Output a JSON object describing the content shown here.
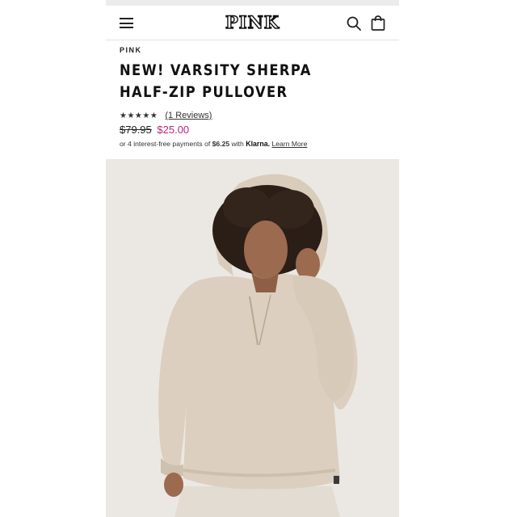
{
  "header": {
    "logo": "PINK",
    "menu_icon": "hamburger-menu-icon",
    "search_icon": "search-icon",
    "bag_icon": "shopping-bag-icon"
  },
  "product": {
    "brand": "PINK",
    "title": "NEW! VARSITY SHERPA HALF-ZIP PULLOVER",
    "stars": "★★★★★",
    "reviews_link": "(1 Reviews)",
    "original_price": "$79.95",
    "sale_price": "$25.00",
    "installment": {
      "prefix": "or 4 interest-free payments of",
      "amount": "$6.25",
      "with": "with",
      "provider": "Klarna.",
      "learn_more": "Learn More"
    }
  },
  "colors": {
    "sale_price": "#b8287a",
    "text": "#111111",
    "photo_background": "#ebe8e4",
    "sweater": "#dccfbf"
  }
}
